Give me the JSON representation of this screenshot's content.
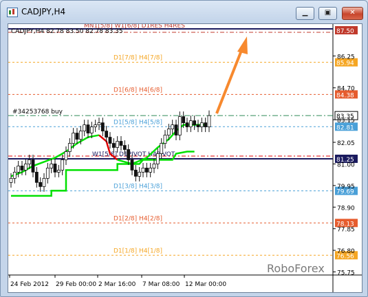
{
  "window": {
    "title": "CADJPY,H4",
    "minimize_icon": "minimize-icon",
    "maximize_icon": "maximize-icon",
    "close_icon": "close-icon"
  },
  "chart": {
    "header": "CADJPY,H4  82.78 83.50 82.78 83.35",
    "watermark": "RoboForex",
    "order_label": "#34253768 buy",
    "current_price": "83.35",
    "levels": [
      {
        "label": "MN1[5/8] W1[6/8] D1RES H4RES",
        "price": "87.50",
        "style": "double",
        "color": "#c0392b"
      },
      {
        "label": "D1[7/8] H4[7/8]",
        "price": "85.94",
        "style": "dash",
        "color": "#f5a623"
      },
      {
        "label": "D1[6/8] H4[6/8]",
        "price": "84.38",
        "style": "dash",
        "color": "#e65c2e"
      },
      {
        "label": "D1[5/8] H4[5/8]",
        "price": "82.81",
        "style": "dash",
        "color": "#4aa0d8"
      },
      {
        "label": "W1[5/8] D1PIVOT H4PIVOT",
        "price": "81.25",
        "style": "solid",
        "color": "#1a1a5e"
      },
      {
        "label": "D1[3/8] H4[3/8]",
        "price": "79.69",
        "style": "dash",
        "color": "#4aa0d8"
      },
      {
        "label": "D1[2/8] H4[2/8]",
        "price": "78.13",
        "style": "dash",
        "color": "#e65c2e"
      },
      {
        "label": "D1[1/8] H4[1/8]",
        "price": "76.56",
        "style": "dash",
        "color": "#f5a623"
      }
    ],
    "y_ticks": [
      "86.25",
      "84.70",
      "83.15",
      "82.05",
      "81.00",
      "79.95",
      "78.90",
      "77.85",
      "76.80",
      "75.75"
    ],
    "x_ticks": [
      "24 Feb 2012",
      "29 Feb 00:00",
      "2 Mar 16:00",
      "7 Mar 08:00",
      "12 Mar 00:00"
    ],
    "colors": {
      "candle": "#111111",
      "trend_up": "#00e000",
      "trend_down": "#e00000",
      "order_line": "#2e8b57",
      "arrow": "#f7892e"
    }
  },
  "chart_data": {
    "type": "candlestick",
    "title": "CADJPY,H4",
    "ylim": [
      75.6,
      87.8
    ],
    "x_ticks": [
      "24 Feb 2012",
      "29 Feb 00:00",
      "2 Mar 16:00",
      "7 Mar 08:00",
      "12 Mar 00:00"
    ],
    "series": [
      {
        "name": "CADJPY",
        "values": [
          80.3,
          80.6,
          80.9,
          80.7,
          81.0,
          81.2,
          80.6,
          80.1,
          79.9,
          80.3,
          80.8,
          81.0,
          80.6,
          80.7,
          81.2,
          81.6,
          82.0,
          82.5,
          82.2,
          82.6,
          82.9,
          82.5,
          82.8,
          82.9,
          83.0,
          82.6,
          82.3,
          82.0,
          81.8,
          82.1,
          81.9,
          81.7,
          81.2,
          80.7,
          80.4,
          80.6,
          80.8,
          80.6,
          80.8,
          81.0,
          81.5,
          82.0,
          82.4,
          82.7,
          82.9,
          82.4,
          83.3,
          83.0,
          82.8,
          83.1,
          82.9,
          82.8,
          83.0,
          82.8,
          83.35
        ]
      }
    ]
  }
}
